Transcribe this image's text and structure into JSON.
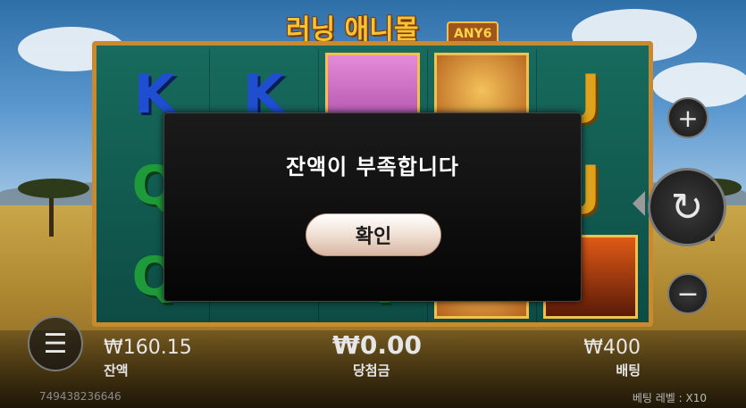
{
  "game": {
    "title": "러닝 애니몰",
    "badge": "ANY6"
  },
  "reels": [
    [
      "K",
      "Q",
      "Q"
    ],
    [
      "K",
      "",
      ""
    ],
    [
      "elephant",
      "",
      "Q"
    ],
    [
      "lion",
      "",
      "lion"
    ],
    [
      "J",
      "J",
      "volcano"
    ]
  ],
  "controls": {
    "plus_icon": "+",
    "minus_icon": "−",
    "spin_icon": "↻",
    "menu_icon": "☰"
  },
  "status": {
    "balance_value": "₩160.15",
    "balance_label": "잔액",
    "win_value": "₩0.00",
    "win_label": "당첨금",
    "bet_value": "₩400",
    "bet_label": "배팅",
    "session_id": "749438236646",
    "bet_level": "베팅 레벨 : X10"
  },
  "dialog": {
    "message": "잔액이 부족합니다",
    "ok_label": "확인"
  },
  "colors": {
    "title": "#f7c334",
    "frame": "#c98a2f",
    "reel_bg": "#176b5d"
  }
}
